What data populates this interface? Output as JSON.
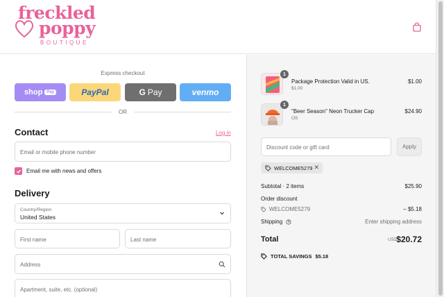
{
  "brand": {
    "line1": "freckled",
    "line2": "poppy",
    "subtitle": "BOUTIQUE",
    "accent_color": "#e8629a"
  },
  "header": {
    "cart_icon": "shopping-bag-icon"
  },
  "express": {
    "label": "Express checkout",
    "shop_pay": {
      "main": "shop",
      "badge": "Pay"
    },
    "paypal": "PayPal",
    "gpay": {
      "g": "G",
      "label": "Pay"
    },
    "venmo": "venmo",
    "or": "OR"
  },
  "contact": {
    "heading": "Contact",
    "login": "Log in",
    "email_placeholder": "Email or mobile phone number",
    "news_label": "Email me with news and offers",
    "news_checked": true
  },
  "delivery": {
    "heading": "Delivery",
    "country_label": "Country/Region",
    "country_value": "United States",
    "first_name_placeholder": "First name",
    "last_name_placeholder": "Last name",
    "address_placeholder": "Address",
    "apartment_placeholder": "Apartment, suite, etc. (optional)"
  },
  "order": {
    "items": [
      {
        "name": "Package Protection Valid in US.",
        "variant": "$1.00",
        "price": "$1.00",
        "quantity": "1"
      },
      {
        "name": "\"Beer Season\" Neon Trucker Cap",
        "variant": "OS",
        "price": "$24.90",
        "quantity": "1"
      }
    ],
    "discount_placeholder": "Discount code or gift card",
    "apply_label": "Apply",
    "applied_code": "WELCOME5279",
    "subtotal_label": "Subtotal · 2 items",
    "subtotal_value": "$25.90",
    "order_discount_label": "Order discount",
    "discount_code": "WELCOME5279",
    "discount_value": "– $5.18",
    "shipping_label": "Shipping",
    "shipping_value": "Enter shipping address",
    "total_label": "Total",
    "currency": "USD",
    "total_value": "$20.72",
    "savings_label": "TOTAL SAVINGS",
    "savings_value": "$5.18"
  }
}
